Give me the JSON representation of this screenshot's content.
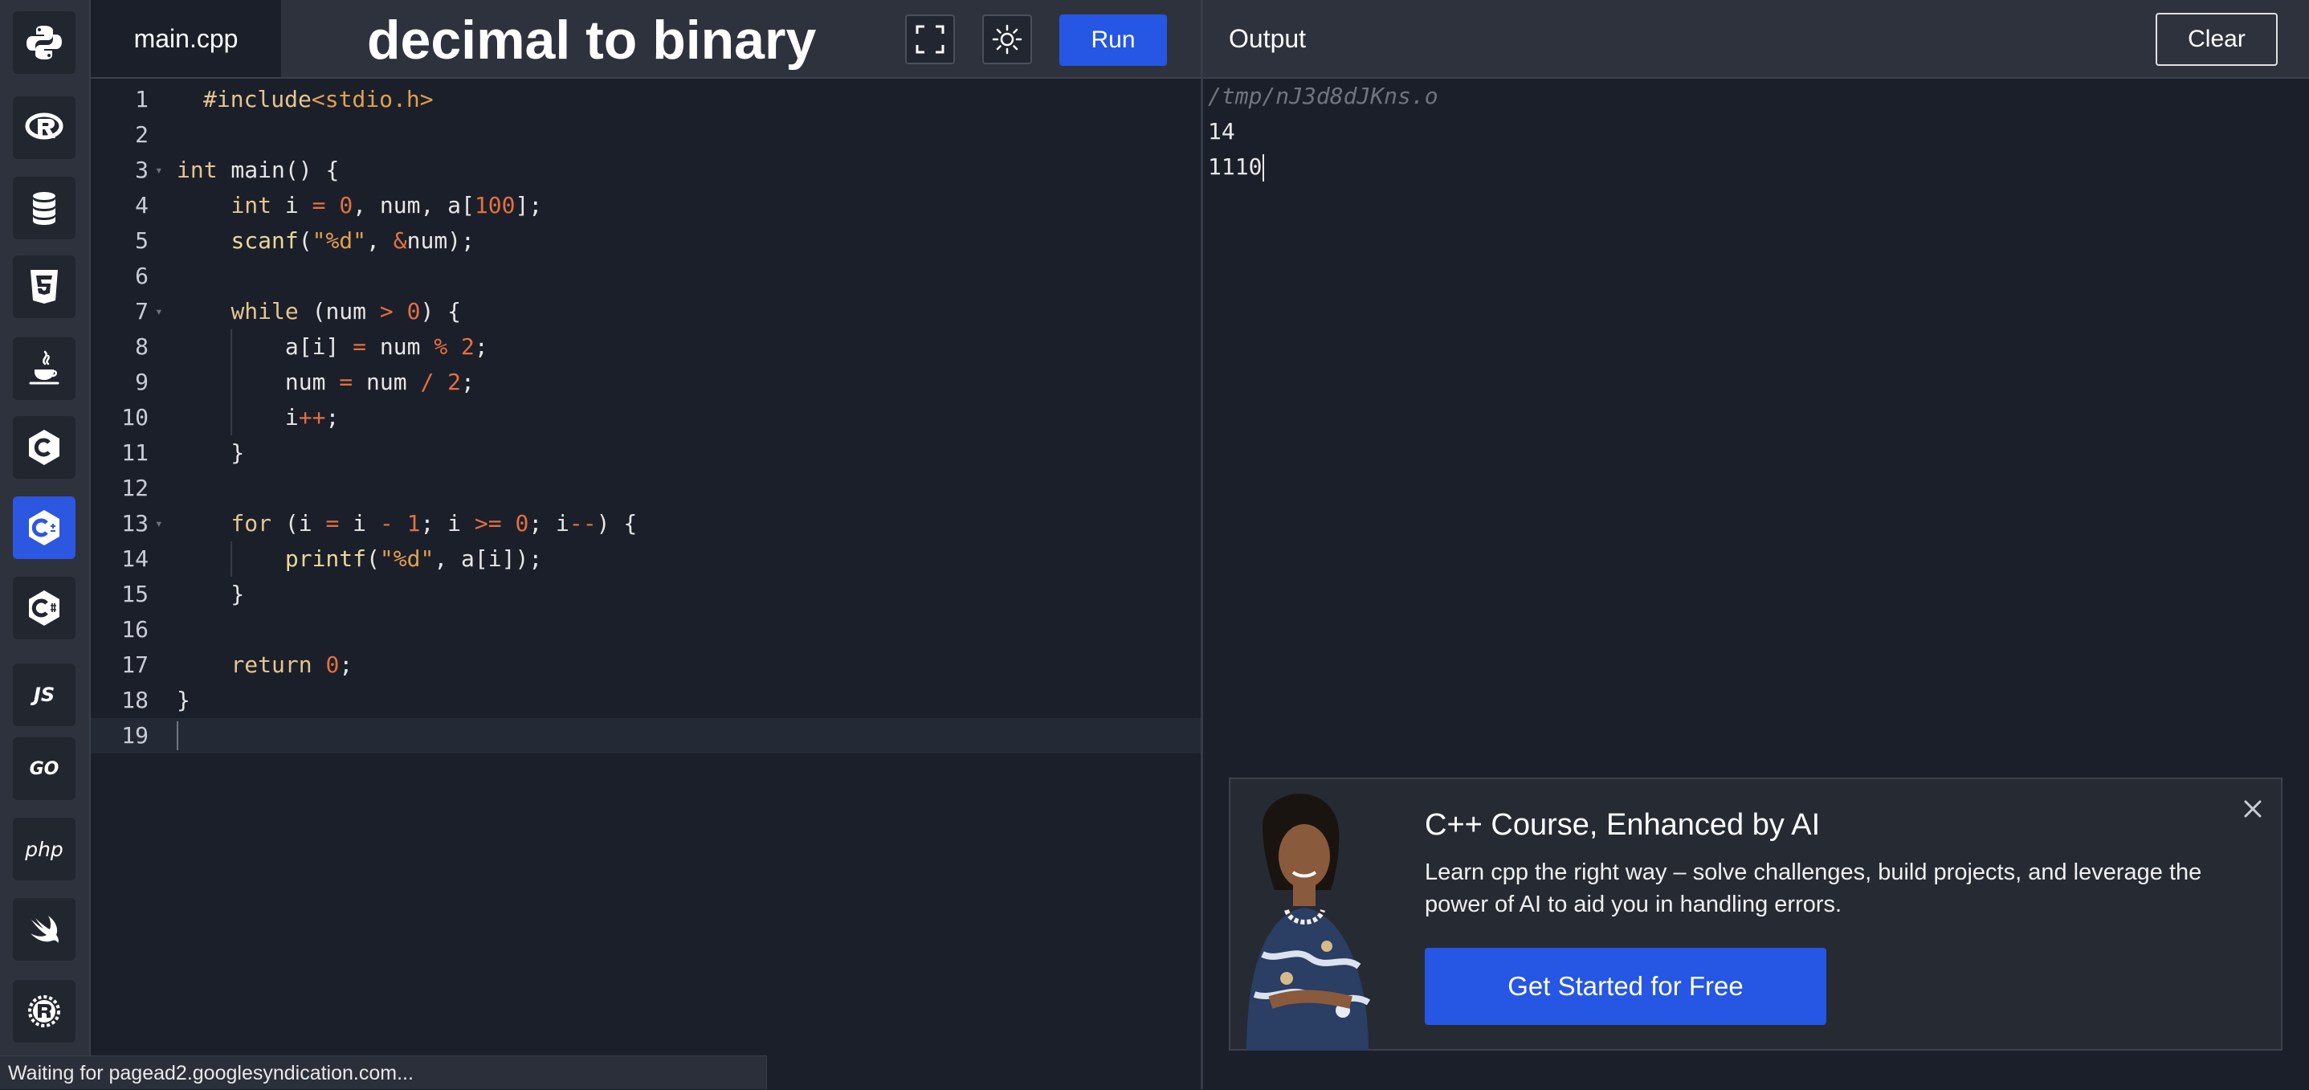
{
  "sidebar": {
    "items": [
      {
        "name": "Python",
        "icon": "python-icon"
      },
      {
        "name": "R",
        "icon": "r-icon"
      },
      {
        "name": "SQL",
        "icon": "database-icon"
      },
      {
        "name": "HTML",
        "icon": "html5-icon"
      },
      {
        "name": "Java",
        "icon": "java-icon"
      },
      {
        "name": "C",
        "icon": "c-icon"
      },
      {
        "name": "C++",
        "icon": "cpp-icon",
        "active": true
      },
      {
        "name": "C#",
        "icon": "csharp-icon"
      },
      {
        "name": "JavaScript",
        "icon": "js-icon",
        "text": "JS"
      },
      {
        "name": "Go",
        "icon": "go-icon",
        "text": "GO"
      },
      {
        "name": "PHP",
        "icon": "php-icon",
        "text": "php"
      },
      {
        "name": "Swift",
        "icon": "swift-icon"
      },
      {
        "name": "Rust",
        "icon": "rust-icon"
      }
    ]
  },
  "editor": {
    "tab_label": "main.cpp",
    "title_overlay": "decimal to binary",
    "run_label": "Run",
    "line_numbers": [
      "1",
      "2",
      "3",
      "4",
      "5",
      "6",
      "7",
      "8",
      "9",
      "10",
      "11",
      "12",
      "13",
      "14",
      "15",
      "16",
      "17",
      "18",
      "19"
    ],
    "lines": [
      "#include<stdio.h>",
      "",
      "int main() {",
      "    int i = 0, num, a[100];",
      "    scanf(\"%d\", &num);",
      "",
      "    while (num > 0) {",
      "        a[i] = num % 2;",
      "        num = num / 2;",
      "        i++;",
      "    }",
      "",
      "    for (i = i - 1; i >= 0; i--) {",
      "        printf(\"%d\", a[i]);",
      "    }",
      "",
      "    return 0;",
      "}",
      ""
    ]
  },
  "output": {
    "label": "Output",
    "clear_label": "Clear",
    "lines": [
      "/tmp/nJ3d8dJKns.o",
      "14",
      "1110"
    ]
  },
  "ad": {
    "title": "C++ Course, Enhanced by AI",
    "text": "Learn cpp the right way – solve challenges, build projects, and leverage the power of AI to aid you in handling errors.",
    "button_label": "Get Started for Free"
  },
  "status_bar": {
    "text": "Waiting for pagead2.googlesyndication.com..."
  },
  "colors": {
    "accent": "#2656e4",
    "background": "#1b1f2a",
    "panel": "#2e323d"
  }
}
